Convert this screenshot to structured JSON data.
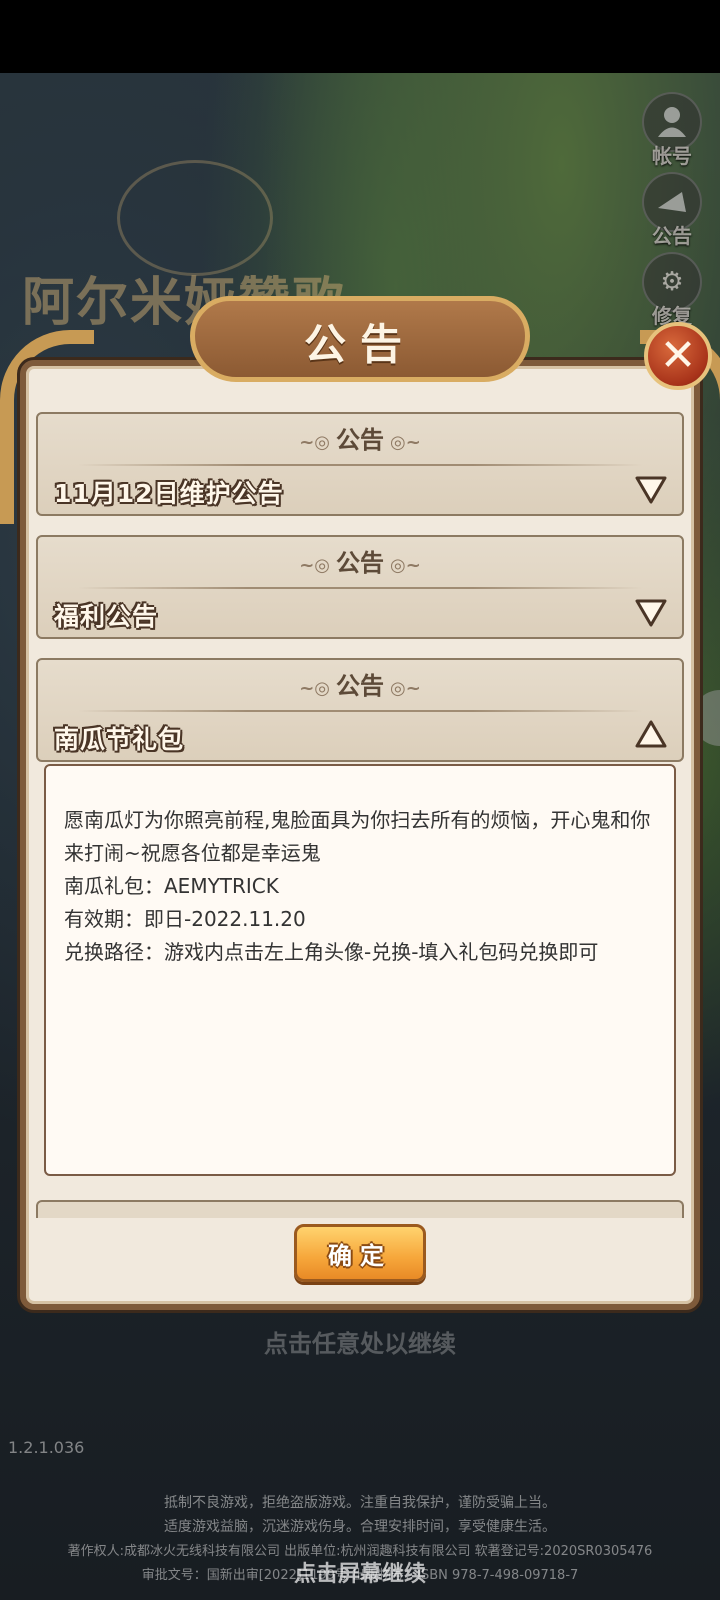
{
  "game": {
    "logo_text": "阿尔米娅赞歌",
    "version": "1.2.1.036"
  },
  "side_buttons": [
    {
      "label": "帐号",
      "icon": "user-icon"
    },
    {
      "label": "公告",
      "icon": "notice-icon"
    },
    {
      "label": "修复",
      "icon": "repair-icon"
    }
  ],
  "dialog": {
    "title": "公告",
    "sections": [
      {
        "category": "公告",
        "name": "11月12日维护公告",
        "expanded": false
      },
      {
        "category": "公告",
        "name": "福利公告",
        "expanded": false
      },
      {
        "category": "公告",
        "name": "南瓜节礼包",
        "expanded": true
      }
    ],
    "content": [
      "愿南瓜灯为你照亮前程,鬼脸面具为你扫去所有的烦恼，开心鬼和你来打闹~祝愿各位都是幸运鬼",
      "南瓜礼包：AEMYTRICK",
      "有效期：即日-2022.11.20",
      "兑换路径：游戏内点击左上角头像-兑换-填入礼包码兑换即可"
    ],
    "confirm_label": "确定"
  },
  "hint_continue": "点击任意处以继续",
  "footer": {
    "line1": "抵制不良游戏，拒绝盗版游戏。注重自我保护，谨防受骗上当。",
    "line2": "适度游戏益脑，沉迷游戏伤身。合理安排时间，享受健康生活。",
    "line3": "著作权人:成都冰火无线科技有限公司 出版单位:杭州润趣科技有限公司 软著登记号:2020SR0305476",
    "line4": "审批文号：国新出审[2022]1199号 出版物号：ISBN 978-7-498-09718-7"
  },
  "tap_screen": "点击屏幕继续"
}
